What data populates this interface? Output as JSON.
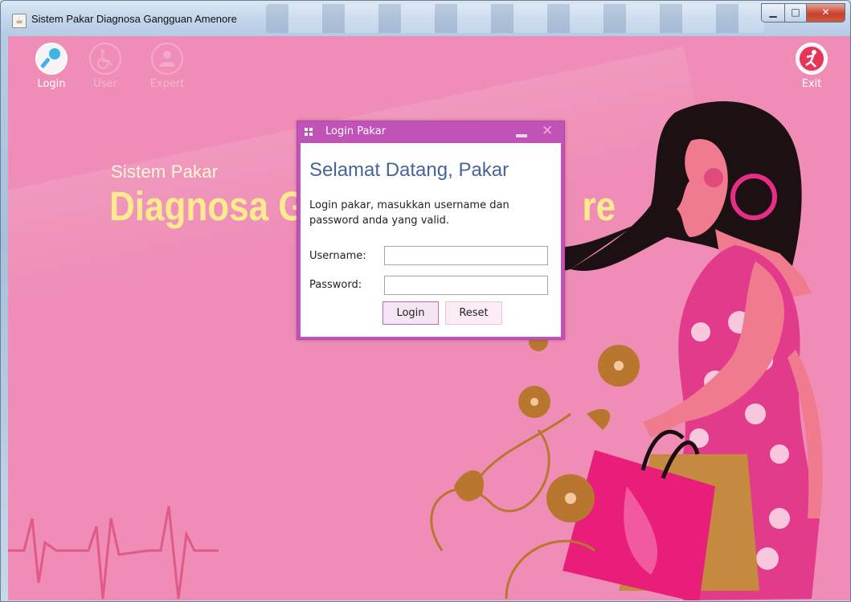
{
  "window": {
    "title": "Sistem Pakar Diagnosa Gangguan Amenore",
    "app_icon": "java-icon",
    "controls": {
      "minimize": "minimize-icon",
      "maximize": "maximize-icon",
      "close": "close-icon"
    }
  },
  "toolbar": {
    "items": [
      {
        "label": "Login",
        "icon": "microphone-icon",
        "enabled": true
      },
      {
        "label": "User",
        "icon": "wheelchair-icon",
        "enabled": false
      },
      {
        "label": "Expert",
        "icon": "person-icon",
        "enabled": false
      }
    ],
    "exit": {
      "label": "Exit",
      "icon": "exit-runner-icon"
    }
  },
  "hero": {
    "subtitle": "Sistem Pakar",
    "title": "Diagnosa Gangguan Amenore",
    "title_visible_left": "Diagnosa G",
    "title_visible_right": "re"
  },
  "dialog": {
    "title": "Login Pakar",
    "welcome": "Selamat Datang, Pakar",
    "description": "Login pakar, masukkan username dan password anda yang valid.",
    "username_label": "Username:",
    "username_value": "",
    "password_label": "Password:",
    "password_value": "",
    "login_button": "Login",
    "reset_button": "Reset"
  },
  "colors": {
    "background_pink": "#ef8db6",
    "dialog_purple": "#c153b8",
    "hero_yellow": "#fdeb8e",
    "welcome_blue": "#47649a"
  }
}
